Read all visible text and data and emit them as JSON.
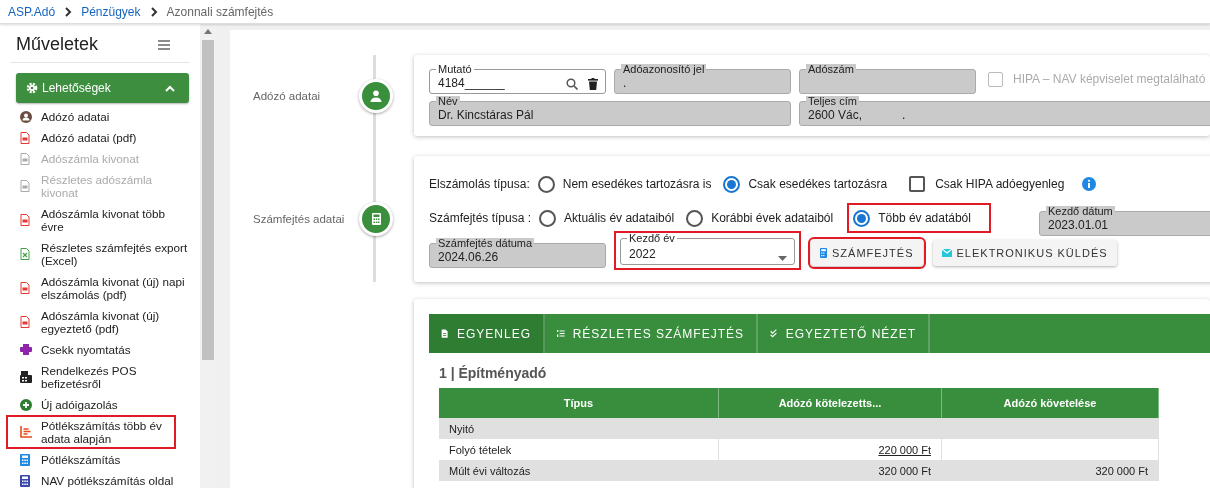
{
  "breadcrumb": [
    {
      "label": "ASP.Adó",
      "link": true
    },
    {
      "label": "Pénzügyek",
      "link": true
    },
    {
      "label": "Azonnali számfejtés",
      "link": false
    }
  ],
  "sidebar": {
    "title": "Műveletek",
    "section": {
      "label": "Lehetőségek",
      "expanded": true
    },
    "items": [
      {
        "label": "Adózó adatai",
        "kind": "person",
        "disabled": false,
        "highlighted": false
      },
      {
        "label": "Adózó adatai (pdf)",
        "kind": "pdf",
        "disabled": false,
        "highlighted": false
      },
      {
        "label": "Adószámla kivonat",
        "kind": "pdf",
        "disabled": true,
        "highlighted": false
      },
      {
        "label": "Részletes adószámla kivonat",
        "kind": "pdf",
        "disabled": true,
        "highlighted": false
      },
      {
        "label": "Adószámla kivonat több évre",
        "kind": "pdf",
        "disabled": false,
        "highlighted": false
      },
      {
        "label": "Részletes számfejtés export (Excel)",
        "kind": "excel",
        "disabled": false,
        "highlighted": false
      },
      {
        "label": "Adószámla kivonat (új) napi elszámolás (pdf)",
        "kind": "pdf",
        "disabled": false,
        "highlighted": false
      },
      {
        "label": "Adószámla kivonat (új) egyeztető (pdf)",
        "kind": "pdf",
        "disabled": false,
        "highlighted": false
      },
      {
        "label": "Csekk nyomtatás",
        "kind": "print",
        "disabled": false,
        "highlighted": false
      },
      {
        "label": "Rendelkezés POS befizetésről",
        "kind": "pos",
        "disabled": false,
        "highlighted": false
      },
      {
        "label": "Új adóigazolás",
        "kind": "plus",
        "disabled": false,
        "highlighted": false
      },
      {
        "label": "Pótlékszámítás több év adata alapján",
        "kind": "chart",
        "disabled": false,
        "highlighted": true
      },
      {
        "label": "Pótlékszámítás",
        "kind": "calc",
        "disabled": false,
        "highlighted": false
      },
      {
        "label": "NAV pótlékszámítás oldal",
        "kind": "calc-nav",
        "disabled": false,
        "highlighted": false
      }
    ]
  },
  "taxpayer": {
    "label": "Adózó adatai",
    "fields_row_1": [
      {
        "label": "Mutató",
        "value": "4184______",
        "kind": "search"
      },
      {
        "label": "Adóazonosító jel",
        "value": "."
      },
      {
        "label": "Adószám"
      }
    ],
    "hipa_checkbox": {
      "label": "HIPA – NAV képviselet megtalálható",
      "checked": false,
      "disabled": true
    },
    "fields_row_2": [
      {
        "label": "Név",
        "value": "Dr. Kincstáras Pál"
      },
      {
        "label": "Teljes cím",
        "value": "2600 Vác,            ."
      }
    ]
  },
  "calculation": {
    "label": "Számfejtés adatai",
    "settlement": {
      "label": "Elszámolás típusa:",
      "options": [
        {
          "label": "Nem esedékes tartozásra is",
          "selected": false
        },
        {
          "label": "Csak esedékes tartozásra",
          "selected": true
        }
      ]
    },
    "hipa_only": {
      "label": "Csak HIPA adóegyenleg",
      "checked": false
    },
    "calc_type": {
      "label": "Számfejtés típusa :",
      "options": [
        {
          "label": "Aktuális év adataiból",
          "selected": false,
          "highlighted": false
        },
        {
          "label": "Korábbi évek adataiból",
          "selected": false,
          "highlighted": false
        },
        {
          "label": "Több év adatából",
          "selected": true,
          "highlighted": true
        }
      ]
    },
    "start_date": {
      "label": "Kezdő dátum",
      "value": "2023.01.01"
    },
    "calc_date": {
      "label": "Számfejtés dátuma",
      "value": "2024.06.26"
    },
    "start_year": {
      "label": "Kezdő év",
      "value": "2022",
      "highlighted": true
    },
    "buttons": [
      {
        "label": "SZÁMFEJTÉS",
        "kind": "calc",
        "highlighted": true
      },
      {
        "label": "ELEKTRONIKUS KÜLDÉS",
        "kind": "mail",
        "highlighted": false
      }
    ]
  },
  "results": {
    "tabs": [
      {
        "label": "EGYENLEG",
        "kind": "doc",
        "selected": true
      },
      {
        "label": "RÉSZLETES SZÁMFEJTÉS",
        "kind": "list",
        "selected": false
      },
      {
        "label": "EGYEZTETŐ NÉZET",
        "kind": "check",
        "selected": false
      }
    ],
    "heading": "1 | Építményadó",
    "table": {
      "columns": [
        "Típus",
        "Adózó kötelezetts...",
        "Adózó követelése"
      ],
      "rows": [
        {
          "cells": [
            {
              "text": "Nyitó"
            }
          ]
        },
        {
          "cells": [
            {
              "text": "Folyó tételek"
            },
            {
              "text": "220 000 Ft",
              "link": true
            }
          ]
        },
        {
          "cells": [
            {
              "text": "Múlt évi változás"
            },
            {
              "text": "320 000 Ft",
              "link": false
            },
            {
              "text": "320 000 Ft",
              "link": false
            }
          ]
        }
      ]
    }
  }
}
